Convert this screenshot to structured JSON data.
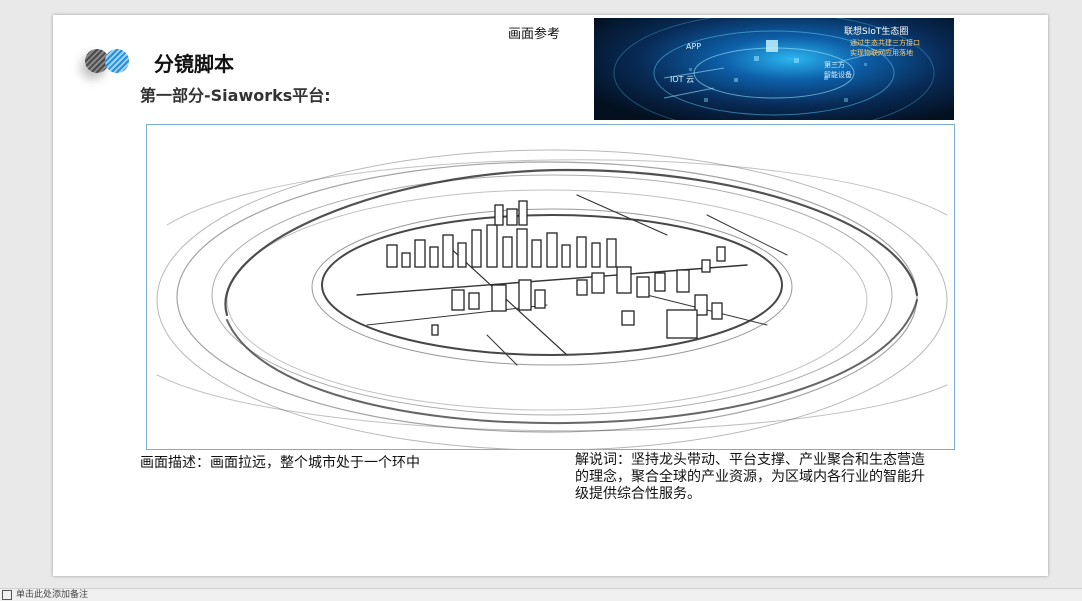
{
  "slide": {
    "title": "分镜脚本",
    "subtitle": "第一部分-Siaworks平台:",
    "reference_label": "画面参考",
    "reference_image": {
      "texts": {
        "heading": "联想SIoT生态圈",
        "line1": "通过生态共建三方接口",
        "line2": "实现物联网应用落地",
        "app": "APP",
        "iot": "IOT 云",
        "right1": "第三方",
        "right2": "智能设备"
      }
    },
    "description": "画面描述：画面拉远，整个城市处于一个环中",
    "narration": "解说词：坚持龙头带动、平台支撑、产业聚合和生态营造的理念，聚合全球的产业资源，为区域内各行业的智能升级提供综合性服务。"
  },
  "statusbar": {
    "notes_placeholder": "单击此处添加备注"
  },
  "colors": {
    "logo_dark": "#4a4a4a",
    "logo_blue": "#2a8fd6",
    "sketch_border": "#7aaed6",
    "reference_glow": "#2bb6f0"
  }
}
